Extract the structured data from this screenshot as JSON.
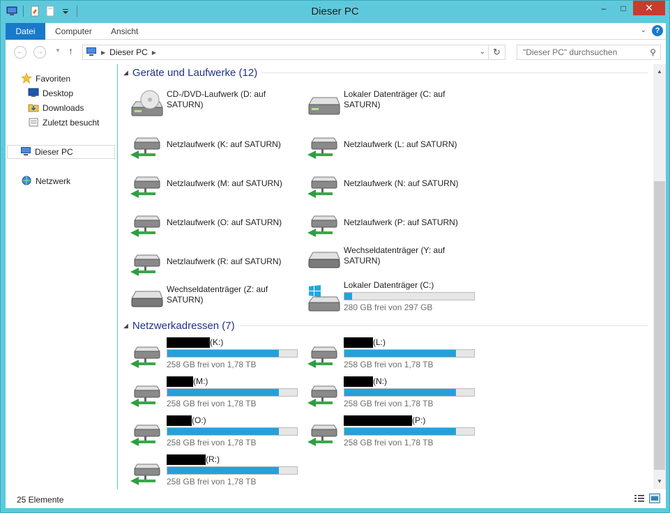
{
  "window": {
    "title": "Dieser PC",
    "controls": {
      "minimize": "–",
      "maximize": "□",
      "close": "✕"
    }
  },
  "quick_access_toolbar": {
    "icons": [
      "computer-icon",
      "properties-icon",
      "new-folder-icon",
      "customize-dropdown-icon"
    ]
  },
  "ribbon": {
    "tabs": [
      "Datei",
      "Computer",
      "Ansicht"
    ]
  },
  "address_bar": {
    "location": "Dieser PC",
    "search_placeholder": "\"Dieser PC\" durchsuchen"
  },
  "nav_pane": {
    "favorites_label": "Favoriten",
    "favorites": [
      "Desktop",
      "Downloads",
      "Zuletzt besucht"
    ],
    "this_pc": "Dieser PC",
    "network": "Netzwerk"
  },
  "groups": {
    "devices": {
      "title": "Geräte und Laufwerke (12)",
      "items": [
        {
          "label": "CD-/DVD-Laufwerk (D: auf SATURN)",
          "icon": "dvd-drive-icon"
        },
        {
          "label": "Lokaler Datenträger (C: auf SATURN)",
          "icon": "hard-drive-icon"
        },
        {
          "label": "Netzlaufwerk (K: auf SATURN)",
          "icon": "network-drive-icon"
        },
        {
          "label": "Netzlaufwerk (L: auf SATURN)",
          "icon": "network-drive-icon"
        },
        {
          "label": "Netzlaufwerk (M: auf SATURN)",
          "icon": "network-drive-icon"
        },
        {
          "label": "Netzlaufwerk (N: auf SATURN)",
          "icon": "network-drive-icon"
        },
        {
          "label": "Netzlaufwerk (O: auf SATURN)",
          "icon": "network-drive-icon"
        },
        {
          "label": "Netzlaufwerk (P: auf SATURN)",
          "icon": "network-drive-icon"
        },
        {
          "label": "Netzlaufwerk (R: auf SATURN)",
          "icon": "network-drive-icon"
        },
        {
          "label": "Wechseldatenträger (Y: auf SATURN)",
          "icon": "removable-drive-icon"
        },
        {
          "label": "Wechseldatenträger (Z: auf SATURN)",
          "icon": "removable-drive-icon"
        },
        {
          "label": "Lokaler Datenträger (C:)",
          "icon": "windows-drive-icon",
          "free": "280 GB frei von 297 GB",
          "used_fraction": 0.06
        }
      ]
    },
    "network": {
      "title": "Netzwerkadressen (7)",
      "items": [
        {
          "label": "(K:)",
          "free": "258 GB frei von 1,78 TB",
          "used_fraction": 0.86
        },
        {
          "label": "(L:)",
          "free": "258 GB frei von 1,78 TB",
          "used_fraction": 0.86
        },
        {
          "label": "(M:)",
          "free": "258 GB frei von 1,78 TB",
          "used_fraction": 0.86
        },
        {
          "label": "(N:)",
          "free": "258 GB frei von 1,78 TB",
          "used_fraction": 0.86
        },
        {
          "label": "(O:)",
          "free": "258 GB frei von 1,78 TB",
          "used_fraction": 0.86
        },
        {
          "label": "(P:)",
          "free": "258 GB frei von 1,78 TB",
          "used_fraction": 0.86
        },
        {
          "label": "(R:)",
          "free": "258 GB frei von 1,78 TB",
          "used_fraction": 0.86
        }
      ]
    }
  },
  "status": {
    "count": "25 Elemente"
  },
  "colors": {
    "accent": "#1979ca",
    "titlebar": "#5fc9dc",
    "group_title": "#1e3287",
    "bar_fill": "#26a0da"
  }
}
